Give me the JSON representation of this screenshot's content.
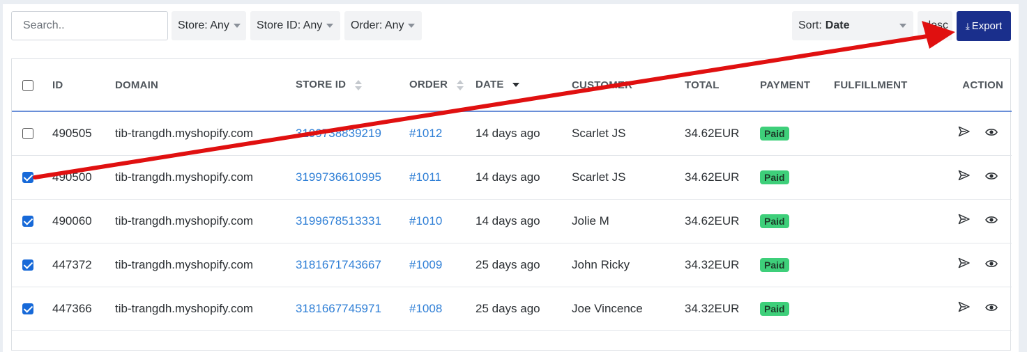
{
  "toolbar": {
    "search_placeholder": "Search..",
    "filters": [
      {
        "label": "Store: Any"
      },
      {
        "label": "Store ID: Any"
      },
      {
        "label": "Order: Any"
      }
    ],
    "sort_label": "Sort:",
    "sort_value": "Date",
    "sort_direction": "desc",
    "export_label": "Export"
  },
  "table": {
    "columns": [
      "ID",
      "DOMAIN",
      "STORE ID",
      "ORDER",
      "DATE",
      "CUSTOMER",
      "TOTAL",
      "PAYMENT",
      "FULFILLMENT",
      "ACTION"
    ],
    "rows": [
      {
        "checked": false,
        "id": "490505",
        "domain": "tib-trangdh.myshopify.com",
        "store_id": "3199738839219",
        "order": "#1012",
        "date": "14 days ago",
        "customer": "Scarlet JS",
        "total": "34.62EUR",
        "payment": "Paid",
        "fulfillment": ""
      },
      {
        "checked": true,
        "id": "490500",
        "domain": "tib-trangdh.myshopify.com",
        "store_id": "3199736610995",
        "order": "#1011",
        "date": "14 days ago",
        "customer": "Scarlet JS",
        "total": "34.62EUR",
        "payment": "Paid",
        "fulfillment": ""
      },
      {
        "checked": true,
        "id": "490060",
        "domain": "tib-trangdh.myshopify.com",
        "store_id": "3199678513331",
        "order": "#1010",
        "date": "14 days ago",
        "customer": "Jolie M",
        "total": "34.62EUR",
        "payment": "Paid",
        "fulfillment": ""
      },
      {
        "checked": true,
        "id": "447372",
        "domain": "tib-trangdh.myshopify.com",
        "store_id": "3181671743667",
        "order": "#1009",
        "date": "25 days ago",
        "customer": "John Ricky",
        "total": "34.32EUR",
        "payment": "Paid",
        "fulfillment": ""
      },
      {
        "checked": true,
        "id": "447366",
        "domain": "tib-trangdh.myshopify.com",
        "store_id": "3181667745971",
        "order": "#1008",
        "date": "25 days ago",
        "customer": "Joe Vincence",
        "total": "34.32EUR",
        "payment": "Paid",
        "fulfillment": ""
      }
    ]
  },
  "colors": {
    "export_button": "#1a2f8c",
    "link": "#2f7fd6",
    "paid_badge": "#3ecf7a",
    "checkbox_checked": "#1769d8",
    "annotation_arrow": "#e01010"
  },
  "icons": {
    "export": "download-icon",
    "send": "send-icon",
    "view": "eye-icon"
  }
}
